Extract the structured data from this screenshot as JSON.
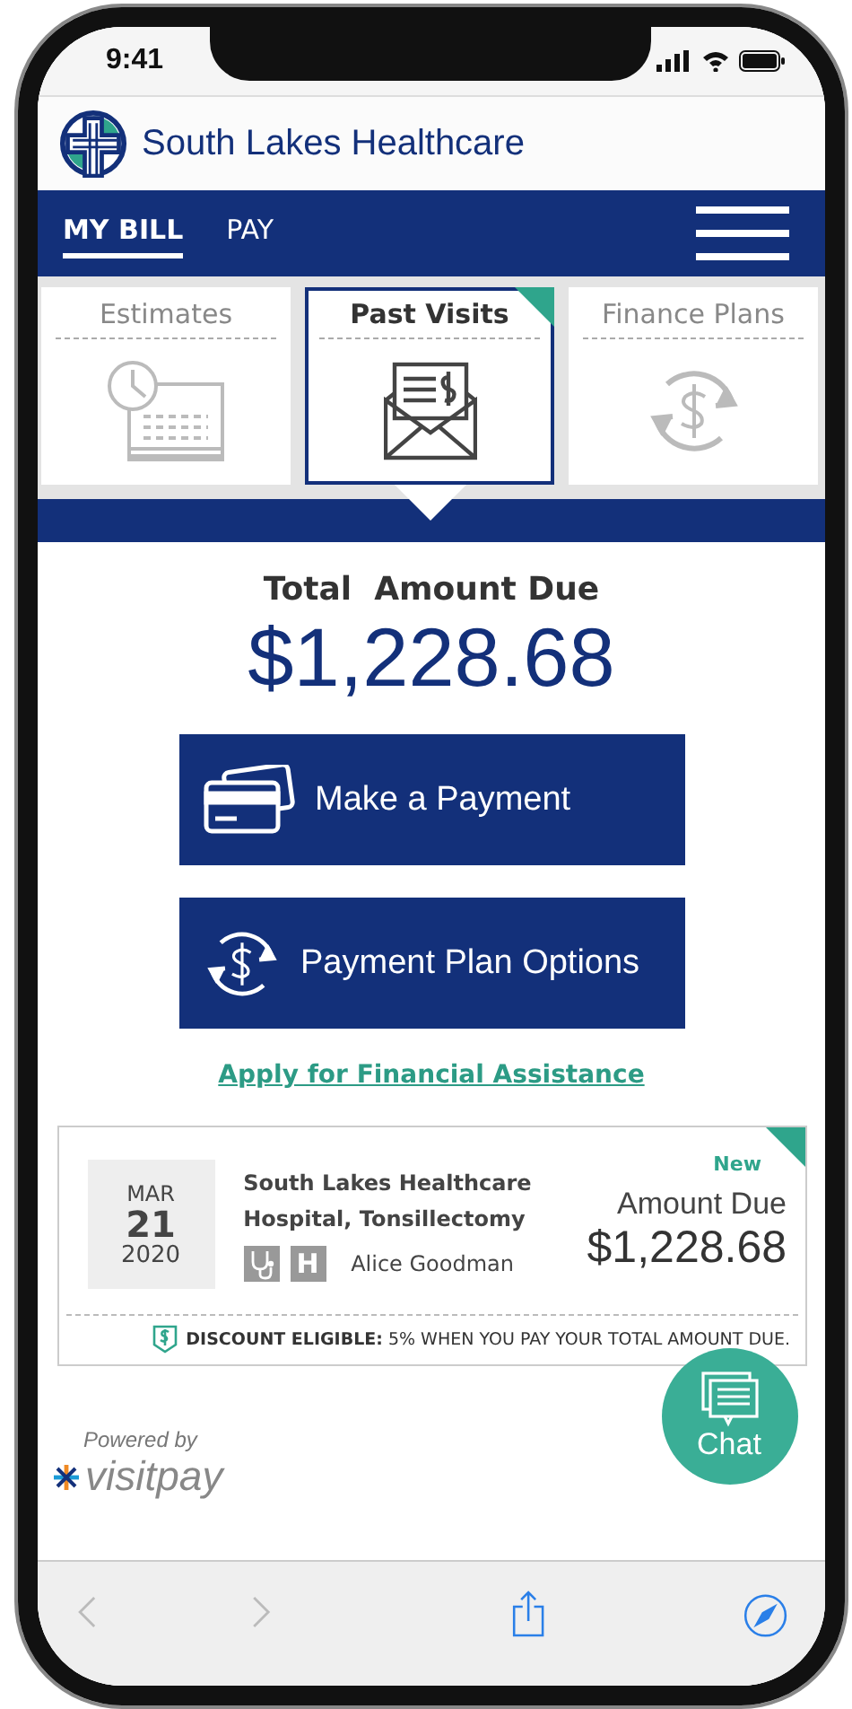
{
  "status_bar": {
    "time": "9:41"
  },
  "header": {
    "title": "South Lakes Healthcare"
  },
  "nav": {
    "tabs": [
      {
        "label": "MY BILL",
        "selected": true
      },
      {
        "label": "PAY",
        "selected": false
      }
    ]
  },
  "section_tabs": [
    {
      "label": "Estimates",
      "kind": "estimates",
      "selected": false
    },
    {
      "label": "Past Visits",
      "kind": "visits",
      "selected": true
    },
    {
      "label": "Finance Plans",
      "kind": "plans",
      "selected": false
    }
  ],
  "total": {
    "label": "Total  Amount Due",
    "amount": "$1,228.68"
  },
  "buttons": [
    {
      "label": "Make a Payment",
      "kind": "card"
    },
    {
      "label": "Payment Plan Options",
      "kind": "plan"
    }
  ],
  "link": "Apply for Financial Assistance",
  "visit": {
    "month": "MAR",
    "day": "21",
    "year": "2020",
    "description": "South Lakes Healthcare Hospital, Tonsillectomy",
    "badge_letter": "H",
    "patient": "Alice Goodman",
    "new": "New",
    "amount_label": "Amount Due",
    "amount": "$1,228.68",
    "discount": "**DISCOUNT ELIGIBLE:** 5%  WHEN YOU PAY YOUR TOTAL AMOUNT DUE."
  },
  "footer": {
    "powered_by": "Powered by",
    "brand": "visitpay"
  },
  "chat": {
    "label": "Chat"
  },
  "toolbar": {
    "back_disabled": true,
    "forward_disabled": true
  }
}
